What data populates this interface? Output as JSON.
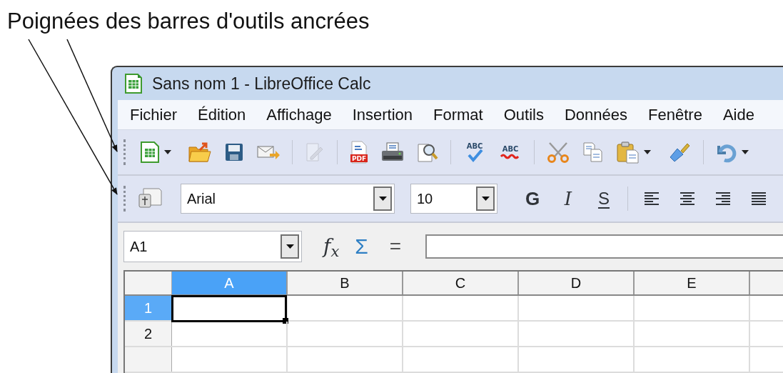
{
  "annotation": "Poignées des barres d'outils ancrées",
  "window": {
    "title": "Sans nom 1 - LibreOffice Calc"
  },
  "menu": [
    {
      "label": "Fichier"
    },
    {
      "label": "Édition"
    },
    {
      "label": "Affichage"
    },
    {
      "label": "Insertion"
    },
    {
      "label": "Format"
    },
    {
      "label": "Outils"
    },
    {
      "label": "Données"
    },
    {
      "label": "Fenêtre"
    },
    {
      "label": "Aide"
    }
  ],
  "standard_toolbar": {
    "items": [
      {
        "kind": "new",
        "dropdown": true,
        "disabled": false
      },
      {
        "kind": "open",
        "dropdown": false,
        "disabled": false
      },
      {
        "kind": "save",
        "dropdown": false,
        "disabled": false
      },
      {
        "kind": "email",
        "dropdown": false,
        "disabled": false
      },
      {
        "kind": "separator"
      },
      {
        "kind": "edit",
        "dropdown": false,
        "disabled": true
      },
      {
        "kind": "separator"
      },
      {
        "kind": "pdf",
        "label": "PDF",
        "dropdown": false,
        "disabled": false
      },
      {
        "kind": "print",
        "dropdown": false,
        "disabled": false
      },
      {
        "kind": "preview",
        "dropdown": false,
        "disabled": false
      },
      {
        "kind": "separator"
      },
      {
        "kind": "spellcheck",
        "label": "ABC",
        "dropdown": false,
        "disabled": false
      },
      {
        "kind": "autospell",
        "label": "ABC",
        "dropdown": false,
        "disabled": false
      },
      {
        "kind": "separator"
      },
      {
        "kind": "cut",
        "dropdown": false,
        "disabled": false
      },
      {
        "kind": "copy",
        "dropdown": false,
        "disabled": false
      },
      {
        "kind": "paste",
        "dropdown": true,
        "disabled": false
      },
      {
        "kind": "clone",
        "dropdown": false,
        "disabled": false
      },
      {
        "kind": "separator"
      },
      {
        "kind": "undo",
        "dropdown": true,
        "disabled": false
      }
    ]
  },
  "formatting_toolbar": {
    "items": [
      {
        "kind": "styles"
      },
      {
        "kind": "font_name",
        "value": "Arial"
      },
      {
        "kind": "font_size",
        "value": "10"
      },
      {
        "kind": "bold",
        "label": "G"
      },
      {
        "kind": "italic",
        "label": "I"
      },
      {
        "kind": "underline",
        "label": "S"
      },
      {
        "kind": "separator"
      },
      {
        "kind": "align_left"
      },
      {
        "kind": "align_center"
      },
      {
        "kind": "align_right"
      },
      {
        "kind": "justify"
      }
    ]
  },
  "formula_bar": {
    "name_box": "A1",
    "function_wizard": "f$_{x}$",
    "sum": "Σ",
    "equals": "="
  },
  "sheet": {
    "columns": [
      {
        "label": "A",
        "selected": true
      },
      {
        "label": "B",
        "selected": false
      },
      {
        "label": "C",
        "selected": false
      },
      {
        "label": "D",
        "selected": false
      },
      {
        "label": "E",
        "selected": false
      }
    ],
    "rows": [
      {
        "label": "1",
        "selected": true
      },
      {
        "label": "2",
        "selected": false
      }
    ]
  }
}
